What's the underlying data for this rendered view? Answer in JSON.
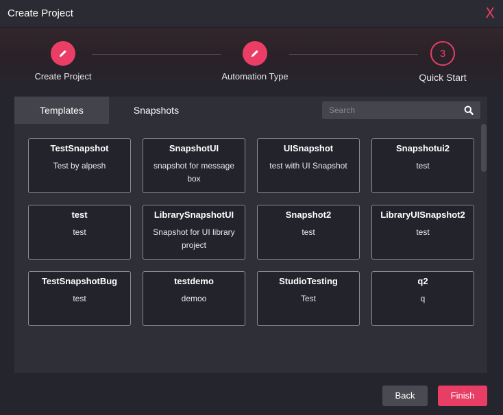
{
  "dialog": {
    "title": "Create Project",
    "close_label": "X"
  },
  "stepper": {
    "steps": [
      {
        "label": "Create Project",
        "state": "done",
        "icon": "pencil-icon"
      },
      {
        "label": "Automation Type",
        "state": "done",
        "icon": "pencil-icon"
      },
      {
        "label": "Quick Start",
        "state": "current",
        "number": "3"
      }
    ]
  },
  "tabs": [
    {
      "label": "Templates",
      "active": false
    },
    {
      "label": "Snapshots",
      "active": true
    }
  ],
  "search": {
    "placeholder": "Search",
    "value": "",
    "icon": "search-icon"
  },
  "snapshots": [
    {
      "name": "TestSnapshot",
      "description": "Test by alpesh"
    },
    {
      "name": "SnapshotUI",
      "description": "snapshot for message box"
    },
    {
      "name": "UISnapshot",
      "description": "test with UI Snapshot"
    },
    {
      "name": "Snapshotui2",
      "description": "test"
    },
    {
      "name": "test",
      "description": "test"
    },
    {
      "name": "LibrarySnapshotUI",
      "description": "Snapshot for UI library project"
    },
    {
      "name": "Snapshot2",
      "description": "test"
    },
    {
      "name": "LibraryUISnapshot2",
      "description": "test"
    },
    {
      "name": "TestSnapshotBug",
      "description": "test"
    },
    {
      "name": "testdemo",
      "description": "demoo"
    },
    {
      "name": "StudioTesting",
      "description": "Test"
    },
    {
      "name": "q2",
      "description": "q"
    }
  ],
  "buttons": {
    "back": "Back",
    "finish": "Finish"
  },
  "colors": {
    "accent": "#e83e65",
    "background": "#25252d",
    "panel": "#2f2f38",
    "card": "#23232b"
  }
}
